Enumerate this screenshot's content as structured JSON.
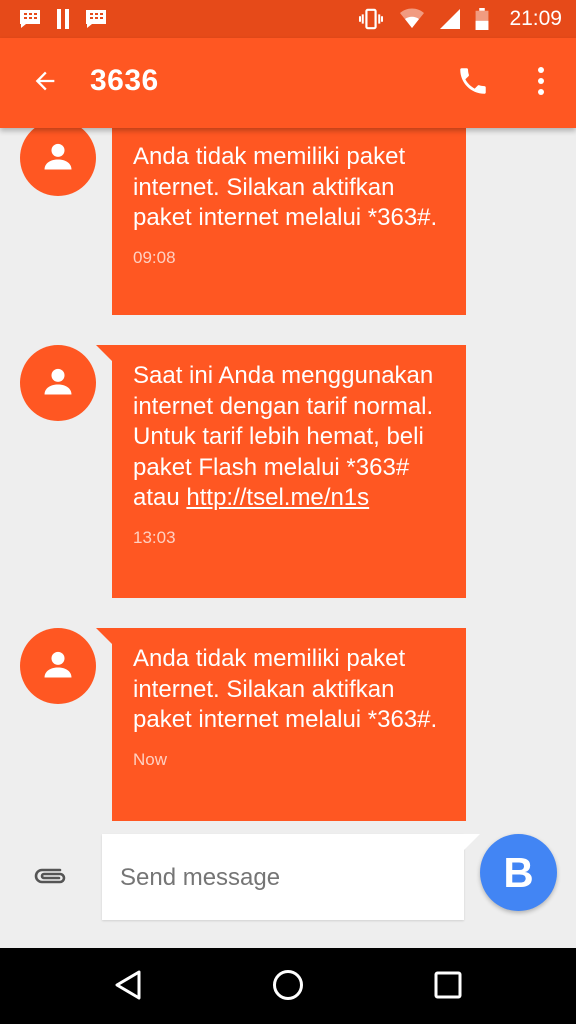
{
  "status_bar": {
    "time": "21:09",
    "icons": [
      "bbm-icon",
      "pause-icon",
      "bbm-icon",
      "vibrate-icon",
      "wifi-icon",
      "signal-icon",
      "battery-icon"
    ]
  },
  "app_bar": {
    "title": "3636",
    "icons": {
      "back": "arrow-back-icon",
      "call": "phone-icon",
      "more": "more-vert-icon"
    }
  },
  "messages": [
    {
      "text": "Anda tidak memiliki paket internet. Silakan aktifkan paket internet melalui *363#.",
      "time": "09:08"
    },
    {
      "text": "Saat ini Anda menggunakan internet dengan tarif normal. Untuk tarif lebih hemat, beli paket Flash melalui *363# atau ",
      "link": "http://tsel.me/n1s",
      "time": "13:03"
    },
    {
      "text": "Anda tidak memiliki paket internet. Silakan aktifkan paket internet melalui *363#.",
      "time": "Now"
    }
  ],
  "compose": {
    "placeholder": "Send message",
    "send_label": "B",
    "attach_icon": "paperclip-icon"
  },
  "nav_bar": {
    "icons": [
      "back-triangle-icon",
      "home-circle-icon",
      "recents-square-icon"
    ]
  },
  "colors": {
    "status_bar": "#e64a19",
    "app_bar": "#ff5722",
    "bubble": "#ff5722",
    "background": "#eeeeee",
    "send_button": "#4285f4"
  }
}
